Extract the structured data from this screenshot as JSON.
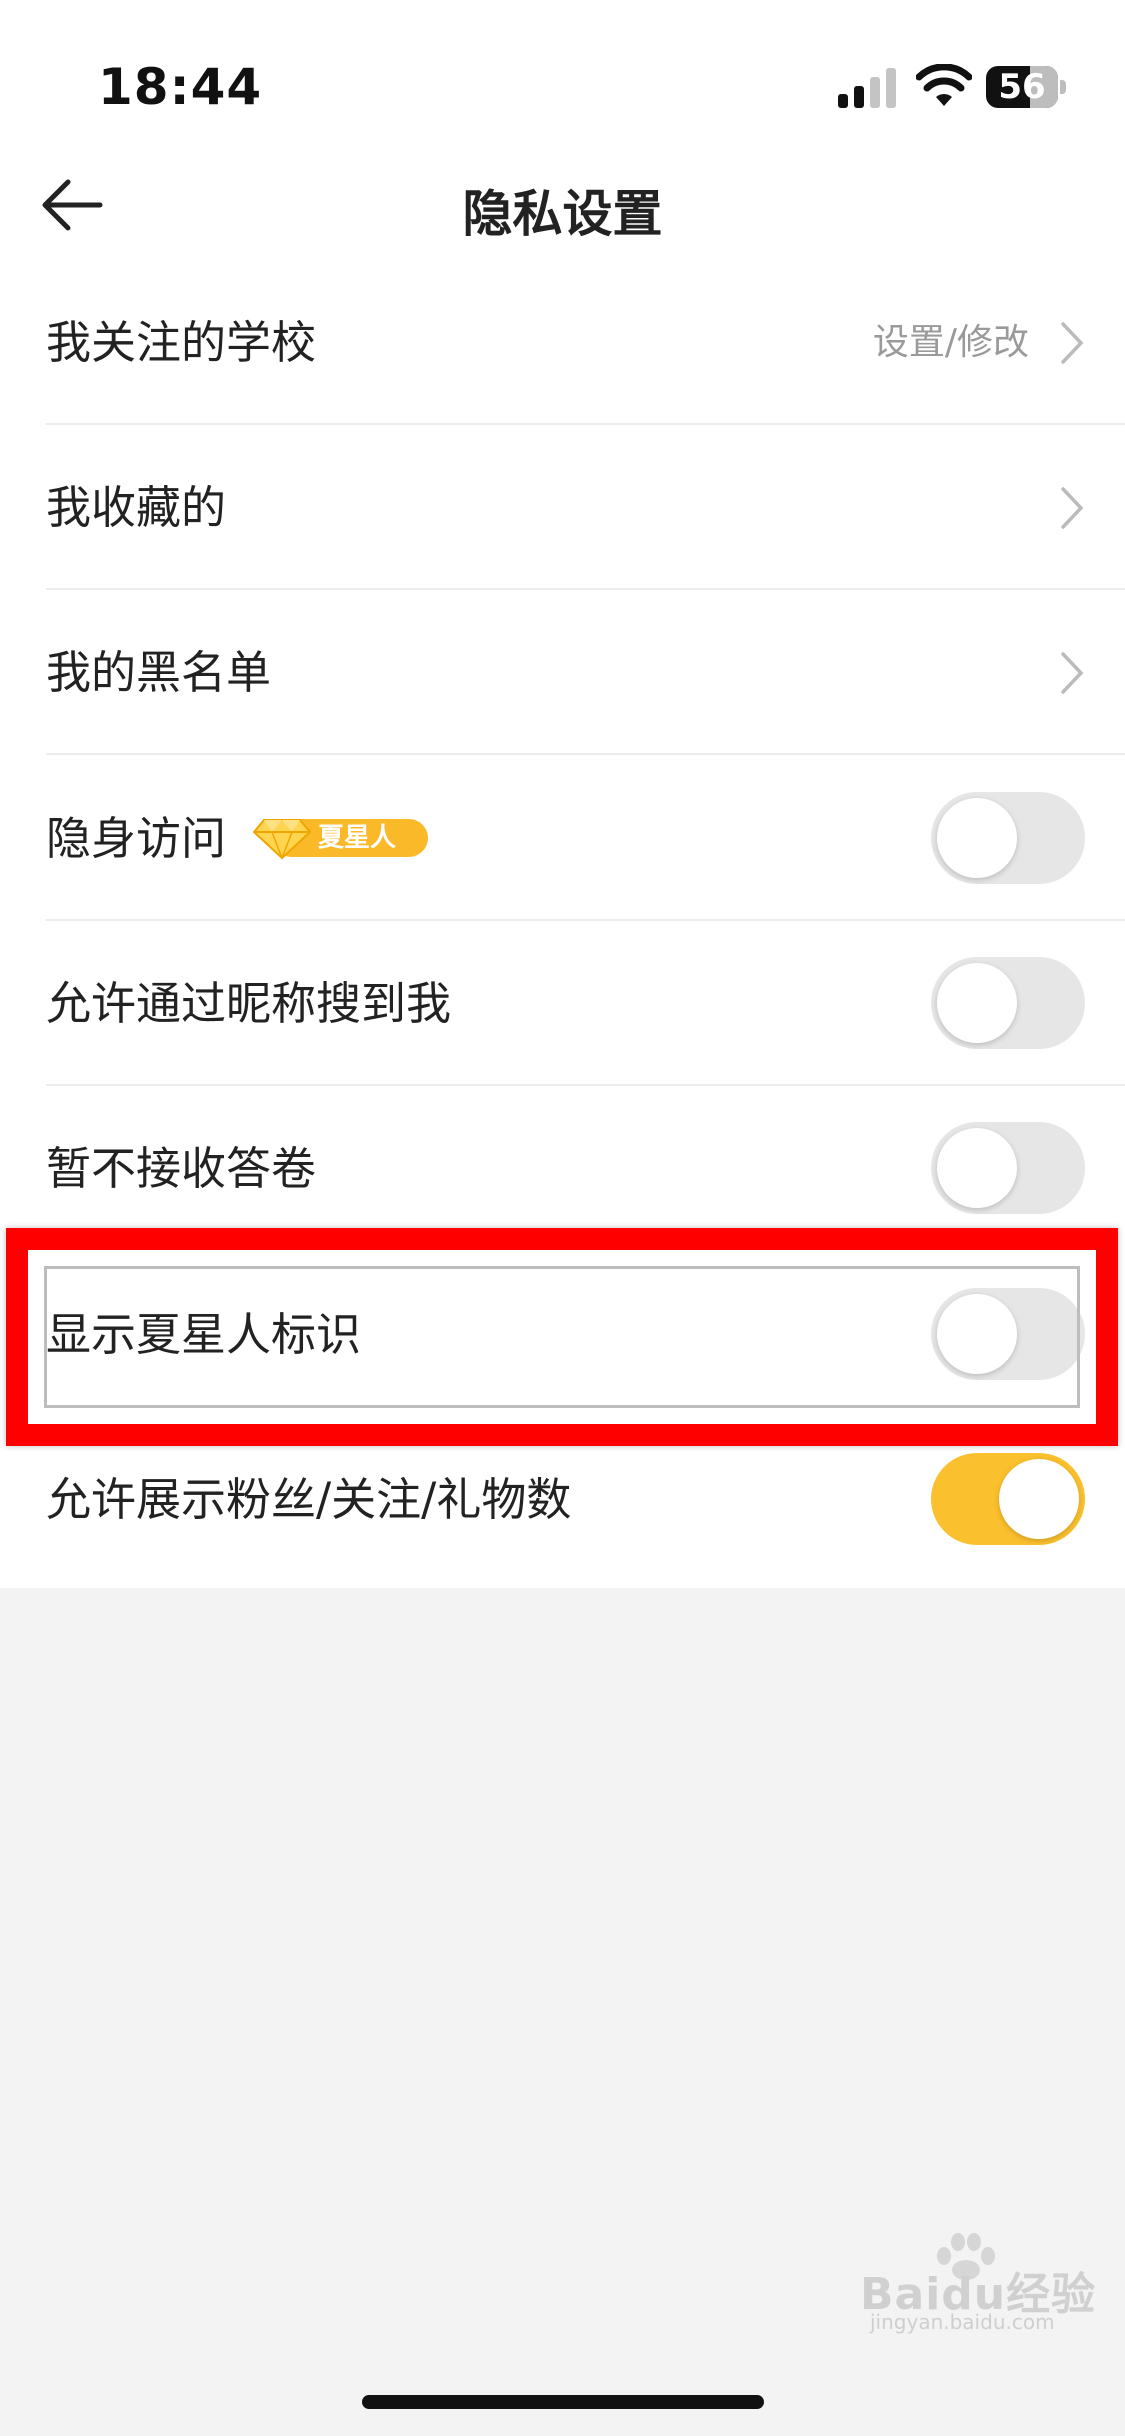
{
  "status_bar": {
    "time": "18:44",
    "battery": "56"
  },
  "nav": {
    "title": "隐私设置"
  },
  "rows": [
    {
      "label": "我关注的学校",
      "right_text": "设置/修改",
      "type": "link"
    },
    {
      "label": "我收藏的",
      "type": "link"
    },
    {
      "label": "我的黑名单",
      "type": "link"
    },
    {
      "label": "隐身访问",
      "badge": "夏星人",
      "type": "toggle",
      "on": false
    },
    {
      "label": "允许通过昵称搜到我",
      "type": "toggle",
      "on": false
    },
    {
      "label": "暂不接收答卷",
      "type": "toggle",
      "on": false
    },
    {
      "label": "显示夏星人标识",
      "type": "toggle",
      "on": false
    },
    {
      "label": "允许展示粉丝/关注/礼物数",
      "type": "toggle",
      "on": true
    }
  ],
  "colors": {
    "accent": "#fbc02d",
    "highlight": "#ff0000",
    "badge": "#f9b929"
  },
  "watermark": {
    "text": "Baidu经验",
    "sub": "jingyan.baidu.com"
  }
}
